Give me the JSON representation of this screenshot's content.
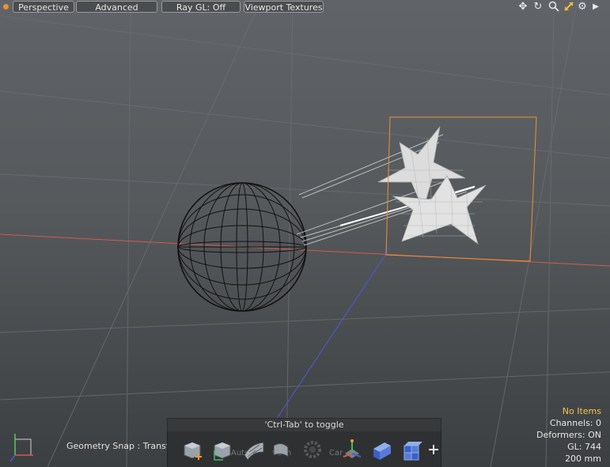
{
  "toolbar_top": {
    "menu_icon": "orange-dot-icon",
    "view_mode": "Perspective",
    "shading": "Advanced",
    "raygl": "Ray GL: Off",
    "textures": "Viewport Textures",
    "icons": [
      "move-icon",
      "rotate-icon",
      "zoom-icon",
      "fit-icon",
      "gear-icon",
      "arrow-right-icon"
    ]
  },
  "hint": "'Ctrl-Tab' to toggle",
  "snap_label": "Geometry Snap : Transform",
  "bottom_toolbar": {
    "ghost_left": "Auto",
    "ghost_mid": "ve in",
    "ghost_right": "Car",
    "icons": [
      "add-item-icon",
      "cube-icon",
      "deform-surface-icon",
      "curve-icon",
      "gear-icon",
      "center-action-icon",
      "cube-blue-icon",
      "multi-cube-icon",
      "plus-icon"
    ]
  },
  "info": {
    "selection": "No Items",
    "channels": "Channels: 0",
    "deformers": "Deformers: ON",
    "gl": "GL: 744",
    "scale": "200 mm"
  },
  "colors": {
    "accent": "#e8913a",
    "highlight": "#f3c34a",
    "selection_box": "#e8913a",
    "x_axis": "#d55a4a",
    "z_axis": "#4a5cd6"
  }
}
